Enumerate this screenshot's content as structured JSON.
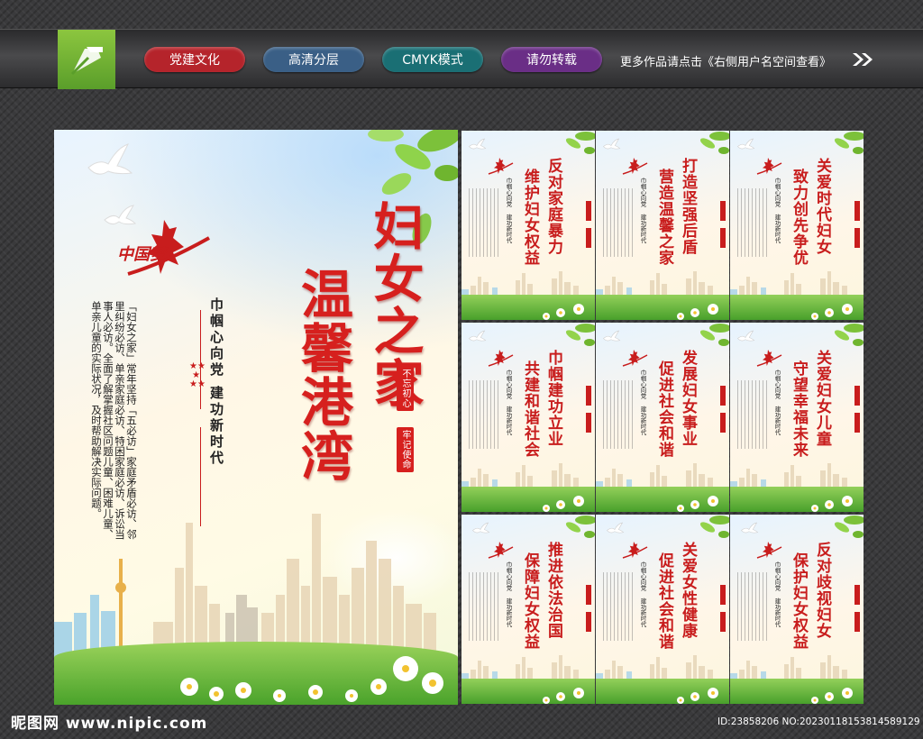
{
  "header": {
    "tags": [
      {
        "label": "党建文化",
        "color": "#b5242b"
      },
      {
        "label": "高清分层",
        "color": "#3a5f86"
      },
      {
        "label": "CMYK模式",
        "color": "#1a6f74"
      },
      {
        "label": "请勿转载",
        "color": "#6a2e86"
      }
    ],
    "more_text": "更多作品请点击《右侧用户名空间查看》",
    "logo_icon": "pen-nib-icon",
    "arrow_icon": "double-chevron-right-icon"
  },
  "main_poster": {
    "logo_text": "中国梦",
    "title_line1": "妇女之家",
    "title_line2": "温馨港湾",
    "subtitle_line1": "巾帼心向党",
    "subtitle_line2": "建功新时代",
    "seal_1": "不忘初心",
    "seal_2": "牢记使命",
    "body_text": "「妇女之家」常年坚持「五必访」家庭矛盾必访、邻里纠纷必访、单亲家庭必访、特困家庭必访、诉讼当事人必访。全面了解掌握社区问题儿童、困难儿童、单亲儿童的实际状况，及时帮助解决实际问题。"
  },
  "cards": [
    {
      "title1": "反对家庭暴力",
      "title2": "维护妇女权益",
      "subtitle": "巾帼心向党 建功新时代"
    },
    {
      "title1": "打造坚强后盾",
      "title2": "营造温馨之家",
      "subtitle": "巾帼心向党 建功新时代"
    },
    {
      "title1": "关爱时代妇女",
      "title2": "致力创先争优",
      "subtitle": "巾帼心向党 建功新时代"
    },
    {
      "title1": "巾帼建功立业",
      "title2": "共建和谐社会",
      "subtitle": "巾帼心向党 建功新时代"
    },
    {
      "title1": "发展妇女事业",
      "title2": "促进社会和谐",
      "subtitle": "巾帼心向党 建功新时代"
    },
    {
      "title1": "关爱妇女儿童",
      "title2": "守望幸福未来",
      "subtitle": "巾帼心向党 建功新时代"
    },
    {
      "title1": "推进依法治国",
      "title2": "保障妇女权益",
      "subtitle": "巾帼心向党 建功新时代"
    },
    {
      "title1": "关爱女性健康",
      "title2": "促进社会和谐",
      "subtitle": "巾帼心向党 建功新时代"
    },
    {
      "title1": "反对歧视妇女",
      "title2": "保护妇女权益",
      "subtitle": "巾帼心向党 建功新时代"
    }
  ],
  "footer": {
    "site": "昵图网 www.nipic.com",
    "id_text": "ID:23858206 NO:20230118153814589129"
  },
  "colors": {
    "title_red": "#d6201e",
    "grass_green": "#4aa32b",
    "logo_green": "#8cc63f"
  }
}
